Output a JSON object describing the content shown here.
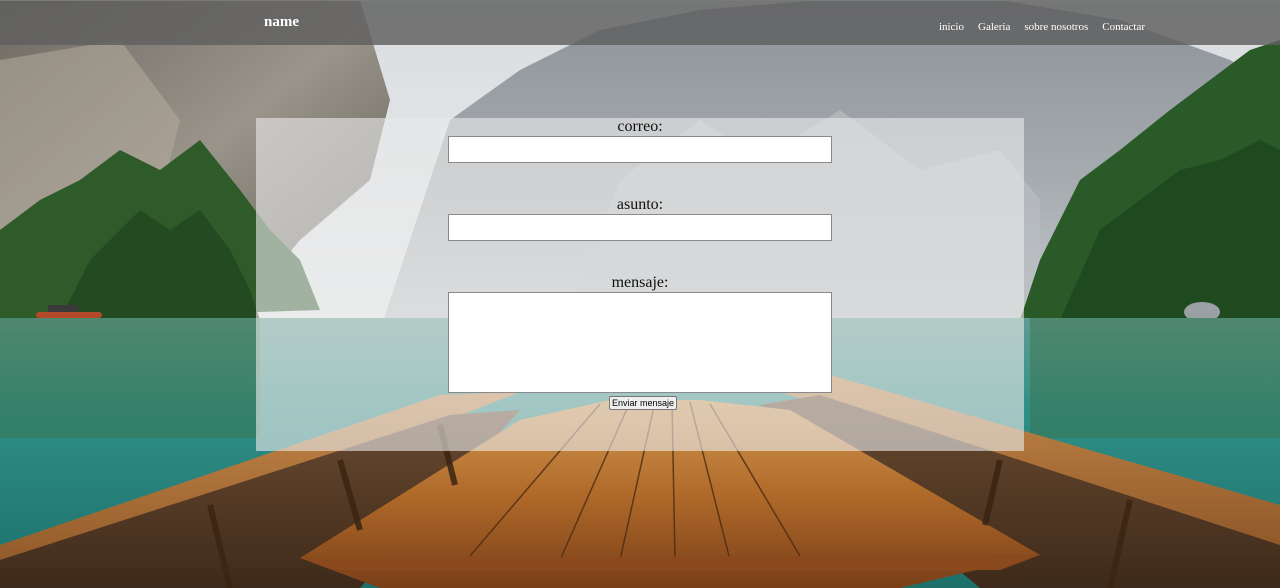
{
  "header": {
    "brand": "name",
    "nav": [
      {
        "label": "inicio"
      },
      {
        "label": "Galeria"
      },
      {
        "label": "sobre nosotros"
      },
      {
        "label": "Contactar"
      }
    ]
  },
  "form": {
    "email_label": "correo:",
    "email_value": "",
    "subject_label": "asunto:",
    "subject_value": "",
    "message_label": "mensaje:",
    "message_value": "",
    "submit_label": "Enviar mensaje"
  },
  "colors": {
    "header_bg": "#5f5f5f",
    "panel_bg": "#e8e8e8",
    "lake": "#2e8f86",
    "forest": "#2f5a2a",
    "boat_wood": "#a0622a"
  }
}
